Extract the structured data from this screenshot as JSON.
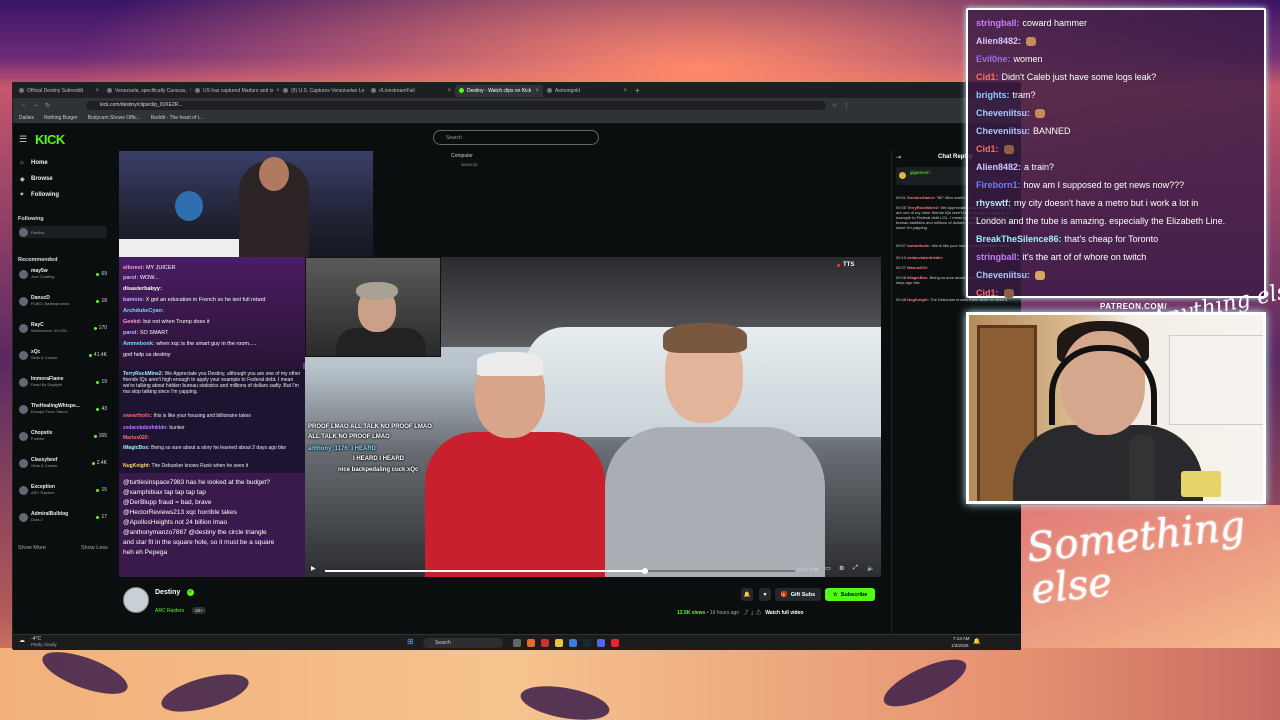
{
  "browser": {
    "tabs": [
      {
        "label": "Official Destiny Subreddit",
        "active": false
      },
      {
        "label": "Venezuela, specifically Caracas,",
        "active": false
      },
      {
        "label": "US has captured Maduro and is",
        "active": false
      },
      {
        "label": "(9) U.S. Captures Venezuelan Le",
        "active": false
      },
      {
        "label": "r/LivestreamFail",
        "active": false
      },
      {
        "label": "Destiny - Watch clips on Kick",
        "active": true
      },
      {
        "label": "Asmongold",
        "active": false
      }
    ],
    "url": "kick.com/destiny/clips/clip_01KE2R...",
    "bookmarks": [
      "Dailies",
      "Nothing Burger",
      "Bodycam Shows Offic...",
      "Reddit - The heart of t..."
    ]
  },
  "kick": {
    "logo": "KICK",
    "search_placeholder": "Search",
    "nav": [
      "Home",
      "Browse",
      "Following"
    ],
    "following_label": "Following",
    "following_item": "Destiny",
    "recommended_label": "Recommended",
    "recommended": [
      {
        "name": "may5w",
        "game": "Just Chatting",
        "viewers": "69"
      },
      {
        "name": "DanucD",
        "game": "PUBG: Battlegrounds",
        "viewers": "18"
      },
      {
        "name": "RayC",
        "game": "Warhammer 40,000:...",
        "viewers": "170"
      },
      {
        "name": "xQc",
        "game": "Slots & Casino",
        "viewers": "41.4K"
      },
      {
        "name": "ImmoraFlame",
        "game": "Dead By Daylight",
        "viewers": "19"
      },
      {
        "name": "TheHealingWhispe...",
        "game": "Escape From Tarkov",
        "viewers": "43"
      },
      {
        "name": "Chopstix",
        "game": "Fortnite",
        "viewers": "165"
      },
      {
        "name": "Classybeef",
        "game": "Slots & Casino",
        "viewers": "2.4K"
      },
      {
        "name": "Exception",
        "game": "ARC Raiders",
        "viewers": "15"
      },
      {
        "name": "AdmiralBulldog",
        "game": "Dota 2",
        "viewers": "17"
      }
    ],
    "show_more": "Show More",
    "show_less": "Show Less",
    "sysinfo_label": "Computer",
    "sysinfo_value": "9800X3D",
    "tts": "TTS",
    "streamer": "Destiny",
    "game": "ARC Raiders",
    "age_badge": "18+",
    "gift_subs": "Gift Subs",
    "subscribe": "Subscribe",
    "views": "12.5K views",
    "posted": "19 hours ago",
    "watch_full": "Watch full video",
    "timecode": "1:21 / 2:00",
    "progress_fraction": 0.68,
    "chat_title": "Chat Replay",
    "pinned_user": "gigameon",
    "right_chat": [
      {
        "time": "00:01",
        "user": "SouloisGamer:",
        "text": "“$2” illion worth of..."
      },
      {
        "time": "00:05",
        "user": "TerryRockMine2:",
        "text": "We Appreciate you Destiny, although you are one of my other friends IQs aren't high enough to apply your example to Federal debt LOL. I mean we're talking about hidden bureau statistics and millions of dollars sadly. But I'm ma stop talking since I'm yapping."
      },
      {
        "time": "00:07",
        "user": "sweartholic:",
        "text": "this is like your housing and billionaire takes"
      },
      {
        "time": "00:10",
        "user": "zxdacvbdznfnkldn:",
        "text": ""
      },
      {
        "time": "00:27",
        "user": "Marius020:",
        "text": ""
      },
      {
        "time": "00:28",
        "user": "iMagicBox:",
        "text": "Being so sure about a story he learned about 2 days ago btw"
      },
      {
        "time": "00:48",
        "user": "NugKnight:",
        "text": "The Debunker knows Runk when he sees it"
      }
    ]
  },
  "overlay_chat_left": {
    "top": [
      {
        "user": "ellorest:",
        "text": "MY JUICER"
      },
      {
        "user": "parol:",
        "text": "WOW..."
      },
      {
        "user": "disasterbabyy:",
        "text": ""
      },
      {
        "user": "bamois:",
        "text": "X got an education in French so he isnt full retard"
      },
      {
        "user": "ArchdukeCyan:",
        "text": ""
      },
      {
        "user": "Geekd:",
        "text": "but not when Trump does it"
      },
      {
        "user": "parol:",
        "text": "SO SMART"
      },
      {
        "user": "Ammebonk:",
        "text": "when xqc is the smart guy in the room....."
      },
      {
        "user": "",
        "text": "god help us destiny"
      }
    ],
    "mid": [
      {
        "user": "TerryRockMine2:",
        "text": "We Appreciate you Destiny, although you are one of my other friends IQs aren't high enough to apply your example to Federal debt. I mean we're talking about hidden bureau statistics and millions of dollars sadly. But I'm ma stop talking since I'm yapping."
      },
      {
        "user": "sweartholic:",
        "text": "this is like your housing and billionaire takes"
      },
      {
        "user": "zxdacvbdznfnkldn:",
        "text": "bunker"
      },
      {
        "user": "Marius020:",
        "text": ""
      },
      {
        "user": "iMagicBox:",
        "text": "Being so sure about a story he learned about 2 days ago btw"
      },
      {
        "user": "NugKnight:",
        "text": "The Debunker knows Runk when he seen it"
      }
    ],
    "bottom": [
      "@turtlesinspace7983 has he looked at the budget?",
      "@xamphibiax tap tap tap tap",
      "@DerBlupp fraud = bad, brave",
      "@HectorReviews213 xqc horrible takes",
      "@ApollosHeights not 24 billion lmao",
      "@anthonymanzo7867 @destiny the circle triangle",
      "and star fit in the square hole, so it must be a square",
      "heh eh Pepega"
    ]
  },
  "video_overlay_text": [
    "PROOF LMAO ALL TALK NO PROOF LMAO",
    "ALL TALK NO PROOF LMAO",
    "anthony_1176: I HEARD",
    "I HEARD I HEARD",
    "nice backpedaling cuck xQc"
  ],
  "overlay_chat_right": [
    {
      "user": "stringball:",
      "text": "coward hammer",
      "color": "#c77dff"
    },
    {
      "user": "Alien8482:",
      "text": "",
      "color": "#d6c8ff"
    },
    {
      "user": "Evil0ne:",
      "text": "women",
      "color": "#9a6cff"
    },
    {
      "user": "Cid1:",
      "text": "Didn't Caleb just have some logs leak?",
      "color": "#ff6b6b"
    },
    {
      "user": "brights:",
      "text": "tram?",
      "color": "#7ad7ff"
    },
    {
      "user": "Cheveniitsu:",
      "text": "",
      "color": "#a9c9ff"
    },
    {
      "user": "Cheveniitsu:",
      "text": "BANNED",
      "color": "#a9c9ff"
    },
    {
      "user": "Cid1:",
      "text": "",
      "color": "#ff6b6b"
    },
    {
      "user": "Alien8482:",
      "text": "a train?",
      "color": "#d6c8ff"
    },
    {
      "user": "Fireborn1:",
      "text": "how am I supposed to get news now???",
      "color": "#6f7dff"
    },
    {
      "user": "rhyswtf:",
      "text": "my city doesn't have a metro but i work a lot in",
      "color": "#bfe6ff"
    },
    {
      "user": "",
      "text": "London and the tube is amazing. especially the Elizabeth Line.",
      "color": "#ffffff"
    },
    {
      "user": "BreakTheSilence86:",
      "text": "that's cheap for Toronto",
      "color": "#9ff0ff"
    },
    {
      "user": "stringball:",
      "text": "it's the art of of whore on twitch",
      "color": "#c77dff"
    },
    {
      "user": "Cheveniitsu:",
      "text": "",
      "color": "#a9c9ff"
    },
    {
      "user": "Cid1:",
      "text": "",
      "color": "#ff6b6b"
    }
  ],
  "patreon": "PATREON.COM/",
  "patreon_sig": "Anything else",
  "signature": "Something\nelse",
  "taskbar": {
    "weather_temp": "-4°C",
    "weather_desc": "Partly cloudy",
    "search": "Search",
    "time": "7:13 AM",
    "date": "1/3/2026"
  },
  "colors": {
    "kick_green": "#53fc18",
    "overlay_border": "#ffffff"
  }
}
